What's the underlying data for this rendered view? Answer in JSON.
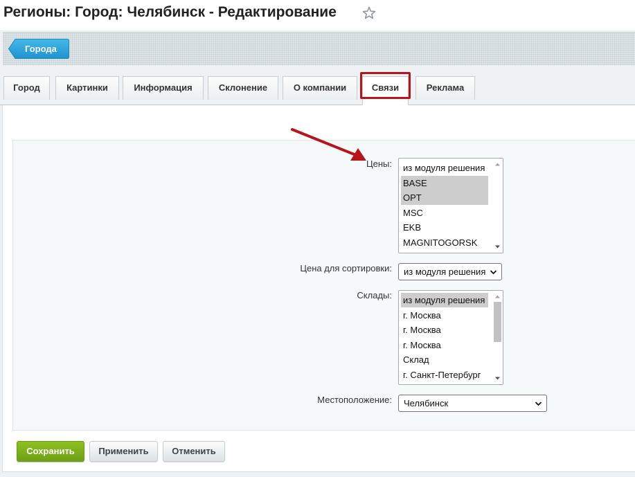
{
  "page": {
    "title": "Регионы: Город: Челябинск - Редактирование"
  },
  "context": {
    "back_label": "Города"
  },
  "tabs": [
    {
      "label": "Город"
    },
    {
      "label": "Картинки"
    },
    {
      "label": "Информация"
    },
    {
      "label": "Склонение"
    },
    {
      "label": "О компании"
    },
    {
      "label": "Связи",
      "active": true
    },
    {
      "label": "Реклама"
    }
  ],
  "form": {
    "prices": {
      "label": "Цены:",
      "options": [
        {
          "text": "из модуля решения",
          "selected": false
        },
        {
          "text": "BASE",
          "selected": true
        },
        {
          "text": "OPT",
          "selected": true
        },
        {
          "text": "MSC",
          "selected": false
        },
        {
          "text": "EKB",
          "selected": false
        },
        {
          "text": "MAGNITOGORSK",
          "selected": false
        }
      ]
    },
    "sort_price": {
      "label": "Цена для сортировки:",
      "value": "из модуля решения"
    },
    "warehouses": {
      "label": "Склады:",
      "options": [
        {
          "text": "из модуля решения",
          "selected": true
        },
        {
          "text": "г. Москва",
          "selected": false
        },
        {
          "text": "г. Москва",
          "selected": false
        },
        {
          "text": "г. Москва",
          "selected": false
        },
        {
          "text": "Склад",
          "selected": false
        },
        {
          "text": "г. Санкт-Петербург",
          "selected": false
        }
      ]
    },
    "location": {
      "label": "Местоположение:",
      "value": "Челябинск"
    }
  },
  "buttons": {
    "save": "Сохранить",
    "apply": "Применить",
    "cancel": "Отменить"
  },
  "colors": {
    "accent_blue": "#2a9fd8",
    "save_green": "#7cb31b",
    "highlight_red": "#b7141b"
  },
  "icons": {
    "title_star": "star-icon",
    "annotation": "red-arrow-icon"
  }
}
